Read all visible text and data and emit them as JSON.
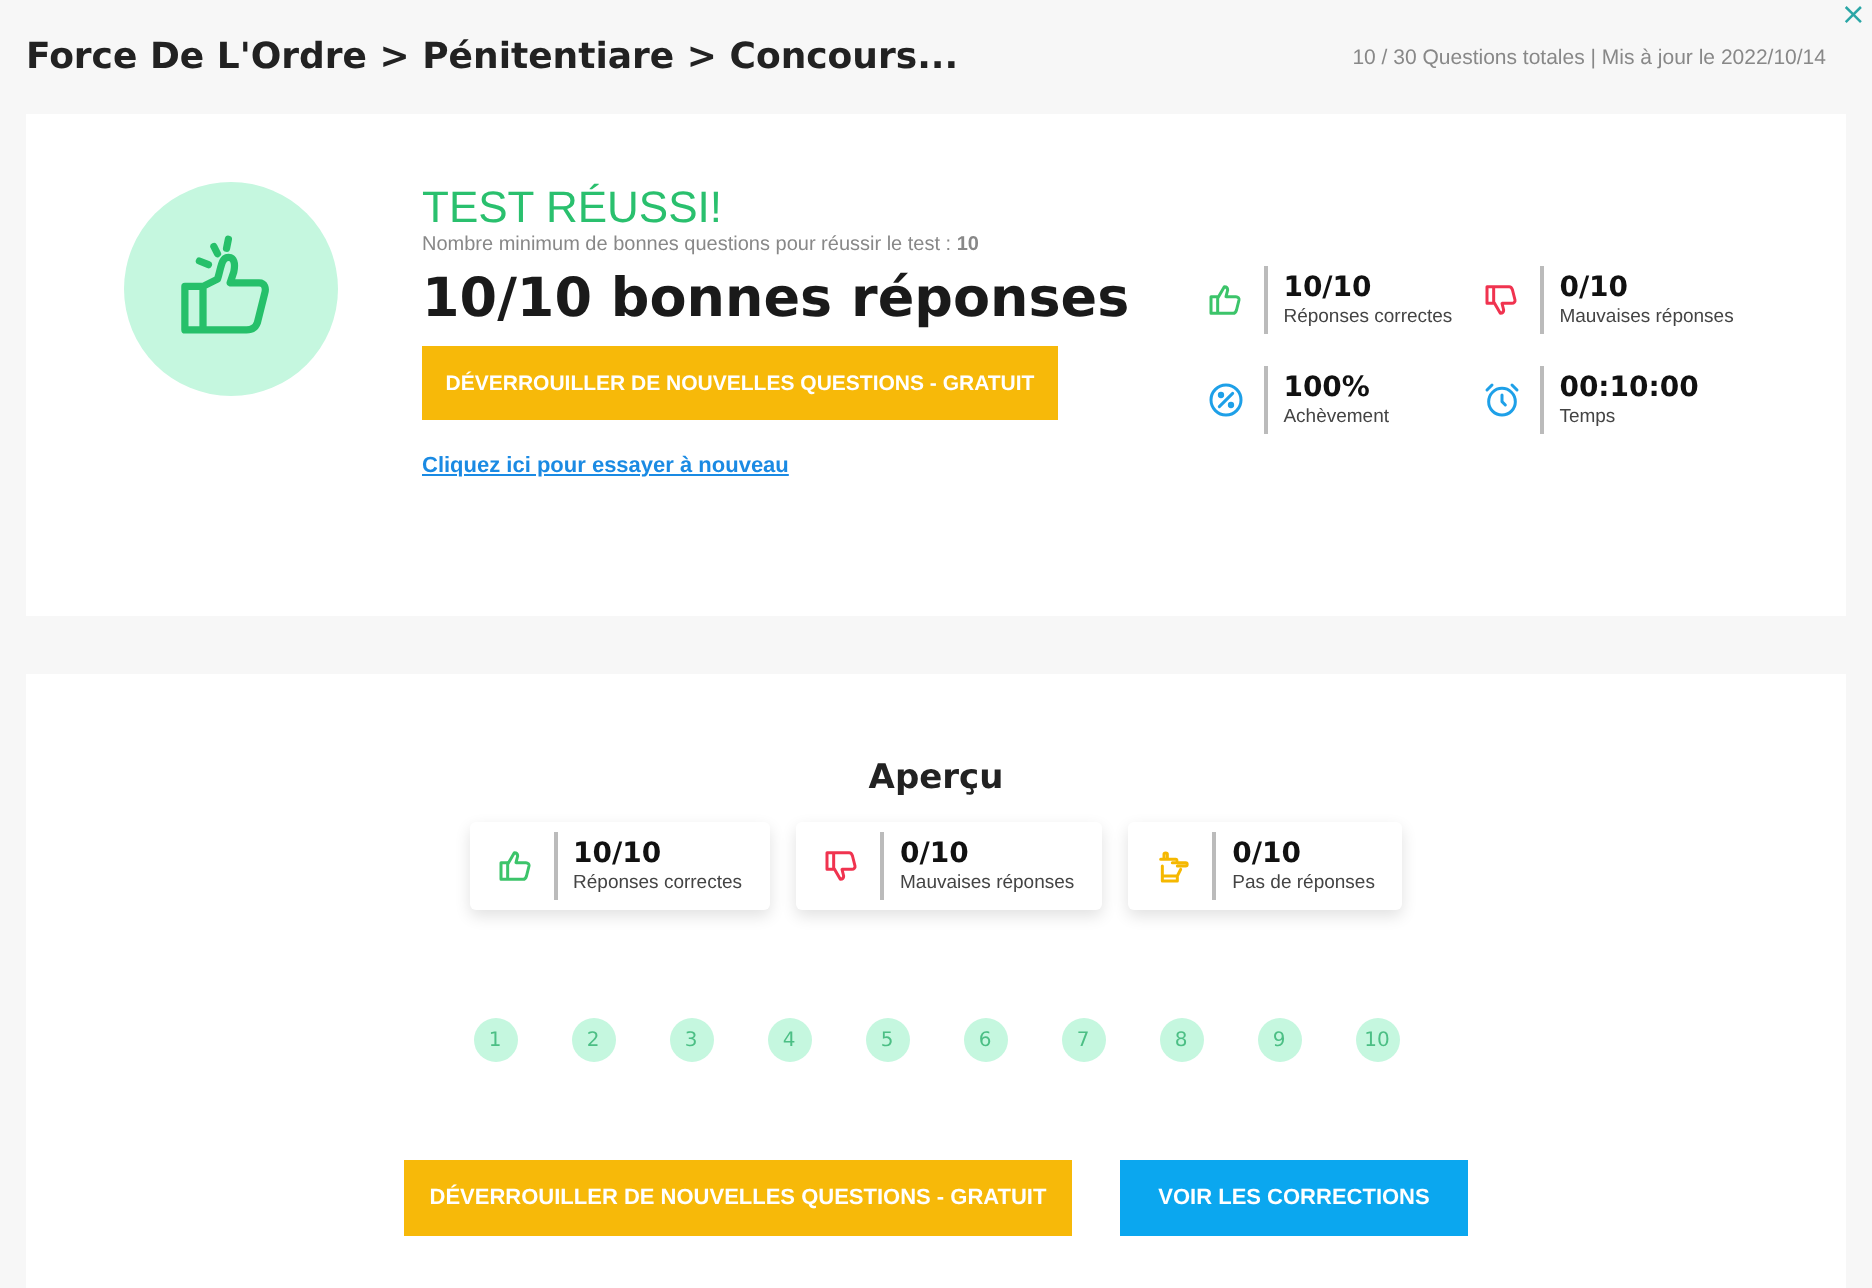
{
  "close": "×",
  "breadcrumb": "Force De L'Ordre > Pénitentiare > Concours...",
  "meta": "10 / 30 Questions totales | Mis à jour le 2022/10/14",
  "result": {
    "status": "TEST RÉUSSI!",
    "minimum": "Nombre minimum de bonnes questions pour réussir le test : **10**",
    "score": "10/10 bonnes réponses",
    "unlock_button": "DÉVERROUILLER DE NOUVELLES QUESTIONS - GRATUIT",
    "retry_link": "Cliquez ici pour essayer à nouveau"
  },
  "stats": [
    {
      "kind": "correct",
      "value": "10/10",
      "label": "Réponses correctes"
    },
    {
      "kind": "wrong",
      "value": "0/10",
      "label": "Mauvaises réponses"
    },
    {
      "kind": "completion",
      "value": "100%",
      "label": "Achèvement"
    },
    {
      "kind": "time",
      "value": "00:10:00",
      "label": "Temps"
    }
  ],
  "overview": {
    "title": "Aperçu",
    "cards": [
      {
        "kind": "correct",
        "value": "10/10",
        "label": "Réponses correctes"
      },
      {
        "kind": "wrong",
        "value": "0/10",
        "label": "Mauvaises réponses"
      },
      {
        "kind": "unanswered",
        "value": "0/10",
        "label": "Pas de réponses"
      }
    ],
    "questions": [
      "1",
      "2",
      "3",
      "4",
      "5",
      "6",
      "7",
      "8",
      "9",
      "10"
    ]
  },
  "buttons": [
    {
      "kind": "unlock",
      "label": "DÉVERROUILLER DE NOUVELLES QUESTIONS - GRATUIT"
    },
    {
      "kind": "corrections",
      "label": "VOIR LES CORRECTIONS"
    }
  ]
}
